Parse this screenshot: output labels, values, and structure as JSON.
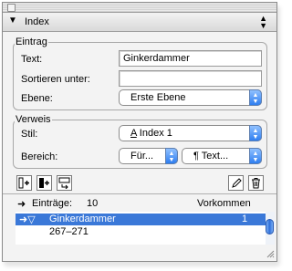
{
  "panel": {
    "title": "Index"
  },
  "eintrag": {
    "legend": "Eintrag",
    "text_label": "Text:",
    "text_value": "Ginkerdammer",
    "sort_label": "Sortieren unter:",
    "sort_value": "",
    "level_label": "Ebene:",
    "level_value": "Erste Ebene"
  },
  "verweis": {
    "legend": "Verweis",
    "style_label": "Stil:",
    "style_value": "Index 1",
    "range_label": "Bereich:",
    "range_value": "Für...",
    "text_popup_value": "Text..."
  },
  "list": {
    "entries_label": "Einträge:",
    "entries_count": "10",
    "occurrences_label": "Vorkommen",
    "rows": [
      {
        "label": "Ginkerdammer",
        "count": "1",
        "selected": true
      },
      {
        "label": "267–271",
        "count": "",
        "selected": false
      }
    ]
  },
  "icons": {
    "add_entry": "add-entry-icon",
    "add_all": "add-all-entries-icon",
    "find_next": "find-next-icon",
    "edit": "pencil-icon",
    "delete": "trash-icon"
  },
  "colors": {
    "selection": "#3a78d8",
    "popup_arrow": "#2e7ef0"
  }
}
